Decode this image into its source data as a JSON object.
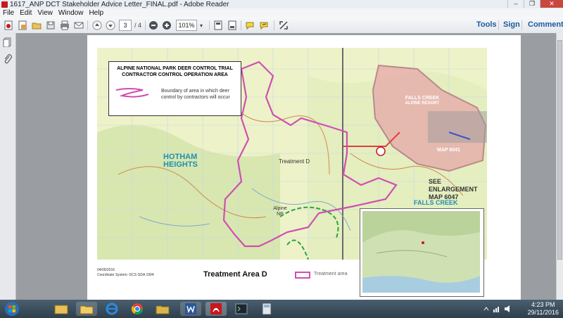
{
  "window": {
    "title": "1617_ANP DCT Stakeholder Advice Letter_FINAL.pdf - Adobe Reader",
    "min": "–",
    "max": "❐",
    "close": "✕"
  },
  "menu": [
    "File",
    "Edit",
    "View",
    "Window",
    "Help"
  ],
  "toolbar": {
    "page_current": "3",
    "page_total": "/ 4",
    "zoom": "101%",
    "tools": "Tools",
    "sign": "Sign",
    "comment": "Comment"
  },
  "map": {
    "legend_title_1": "ALPINE NATIONAL PARK DEER CONTROL TRIAL",
    "legend_title_2": "CONTRACTOR CONTROL OPERATION AREA",
    "legend_desc": "Boundary of area in which deer control by contractors will occur",
    "labels": {
      "hotham": "HOTHAM HEIGHTS",
      "treatment": "Treatment D",
      "falls_creek": "FALLS CREEK",
      "see_enlargement": "SEE ENLARGEMENT MAP 6047",
      "falls_creek_2": "FALLS CREEK",
      "map_no": "MAP 6041",
      "alpine": "Alpine NP",
      "alpine_resort": "ALPINE RESORT"
    }
  },
  "page_footer": {
    "date": "04/05/2016",
    "coords": "Coordinate System: GCS GDA 1994",
    "title": "Treatment Area D",
    "legend_label": "Treatment area"
  },
  "tray": {
    "time": "4:23 PM",
    "date": "29/11/2016"
  },
  "colors": {
    "boundary": "#cf4fb2",
    "resort": "#e7a3a6",
    "taskbar": "#3a4d5c"
  }
}
